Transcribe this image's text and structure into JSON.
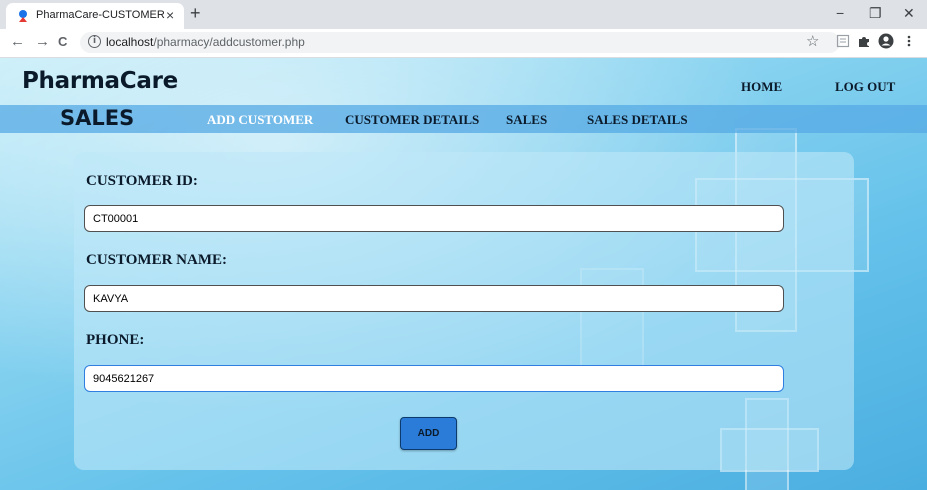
{
  "browser": {
    "tab_title": "PharmaCare-CUSTOMER",
    "tab_close": "×",
    "new_tab": "+",
    "window_controls": {
      "minimize": "−",
      "restore": "❐",
      "close": "✕"
    },
    "nav": {
      "back": "←",
      "forward": "→",
      "reload": "C"
    },
    "url_host": "localhost",
    "url_path": "/pharmacy/addcustomer.php",
    "icons": [
      "favicon-icon",
      "info-icon",
      "star-icon",
      "reader-icon",
      "extensions-icon",
      "profile-icon",
      "menu-icon"
    ]
  },
  "header": {
    "brand": "PharmaCare",
    "links": {
      "home": "HOME",
      "logout": "LOG OUT"
    }
  },
  "navbar": {
    "title": "SALES",
    "items": [
      {
        "label": "ADD CUSTOMER",
        "active": true
      },
      {
        "label": "CUSTOMER DETAILS",
        "active": false
      },
      {
        "label": "SALES",
        "active": false
      },
      {
        "label": "SALES DETAILS",
        "active": false
      }
    ]
  },
  "form": {
    "fields": [
      {
        "label": "CUSTOMER ID:",
        "value": "CT00001"
      },
      {
        "label": "CUSTOMER NAME:",
        "value": "KAVYA"
      },
      {
        "label": "PHONE:",
        "value": "9045621267"
      }
    ],
    "submit_label": "ADD"
  },
  "colors": {
    "page_background": "#64c1ea",
    "navbar": "#56aae4",
    "button": "#2b7bd8",
    "active_link": "#ffffff",
    "text": "#0b1a2a"
  }
}
